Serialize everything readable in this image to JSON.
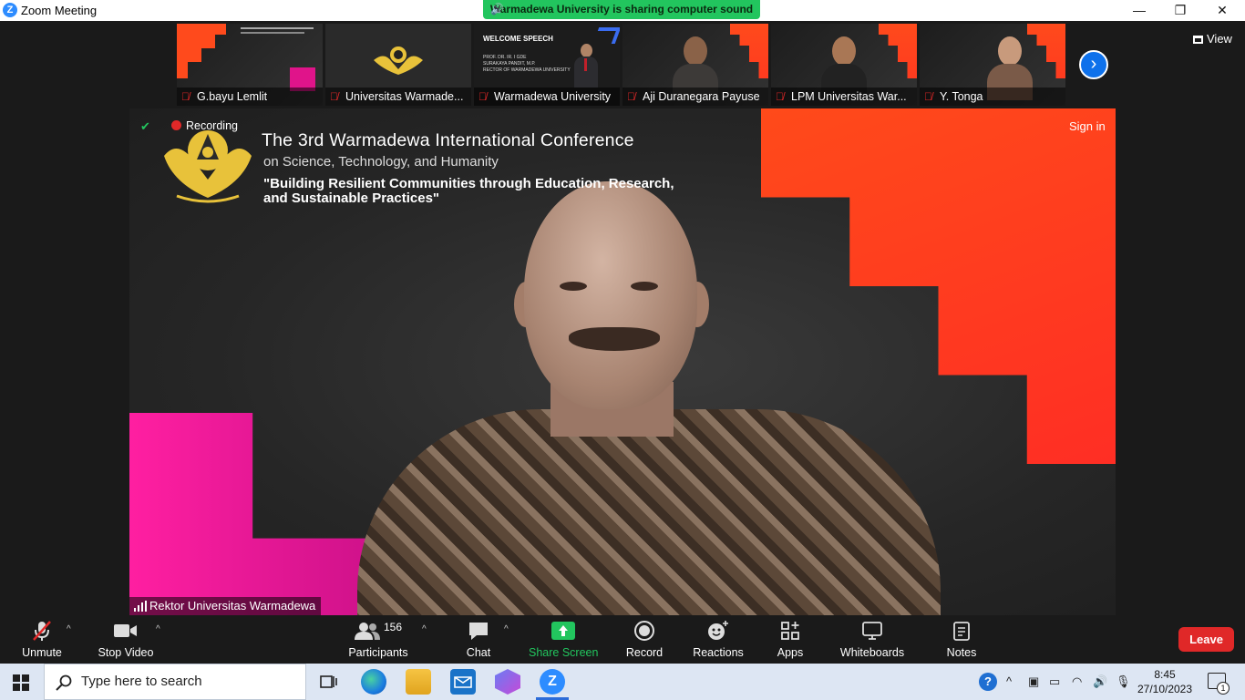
{
  "window": {
    "title": "Zoom Meeting",
    "minimize": "—",
    "restore": "❐",
    "close": "✕",
    "logo": "Z"
  },
  "share_banner": {
    "text": "Warmadewa University is sharing computer sound"
  },
  "thumbnails": [
    {
      "name": "G.bayu Lemlit",
      "kind": "slide"
    },
    {
      "name": "Universitas Warmade...",
      "kind": "logo"
    },
    {
      "name": "Warmadewa University",
      "kind": "speech",
      "slide_title": "WELCOME SPEECH",
      "slide_lines": [
        "PROF. DR. IR. I GDE",
        "SURAKAYA PANDIT, M.P.",
        "RECTOR OF WARMADEWA UNIVERSITY"
      ]
    },
    {
      "name": "Aji Duranegara Payuse",
      "kind": "person"
    },
    {
      "name": "LPM Universitas War...",
      "kind": "person"
    },
    {
      "name": "Y. Tonga",
      "kind": "person"
    }
  ],
  "view_button": {
    "label": "View",
    "icon": "grid-icon"
  },
  "main_video": {
    "recording_label": "Recording",
    "sign_in": "Sign in",
    "speaker_name": "Rektor Universitas Warmadewa",
    "conference": {
      "title": "The 3rd Warmadewa International Conference",
      "subtitle": "on Science, Technology, and Humanity",
      "theme_line1": "\"Building Resilient Communities through Education, Research,",
      "theme_line2": "and Sustainable Practices\""
    }
  },
  "toolbar": {
    "unmute": "Unmute",
    "stop_video": "Stop Video",
    "participants": "Participants",
    "participants_count": "156",
    "chat": "Chat",
    "share_screen": "Share Screen",
    "record": "Record",
    "reactions": "Reactions",
    "apps": "Apps",
    "whiteboards": "Whiteboards",
    "notes": "Notes",
    "leave": "Leave"
  },
  "taskbar": {
    "search_placeholder": "Type here to search",
    "time": "8:45",
    "date": "27/10/2023",
    "notification_count": "1"
  },
  "colors": {
    "zoom_blue": "#0e71eb",
    "share_green": "#22c55e",
    "leave_red": "#e02828",
    "stair_orange": "#ff4a1a",
    "pink": "#ff1fa1"
  }
}
